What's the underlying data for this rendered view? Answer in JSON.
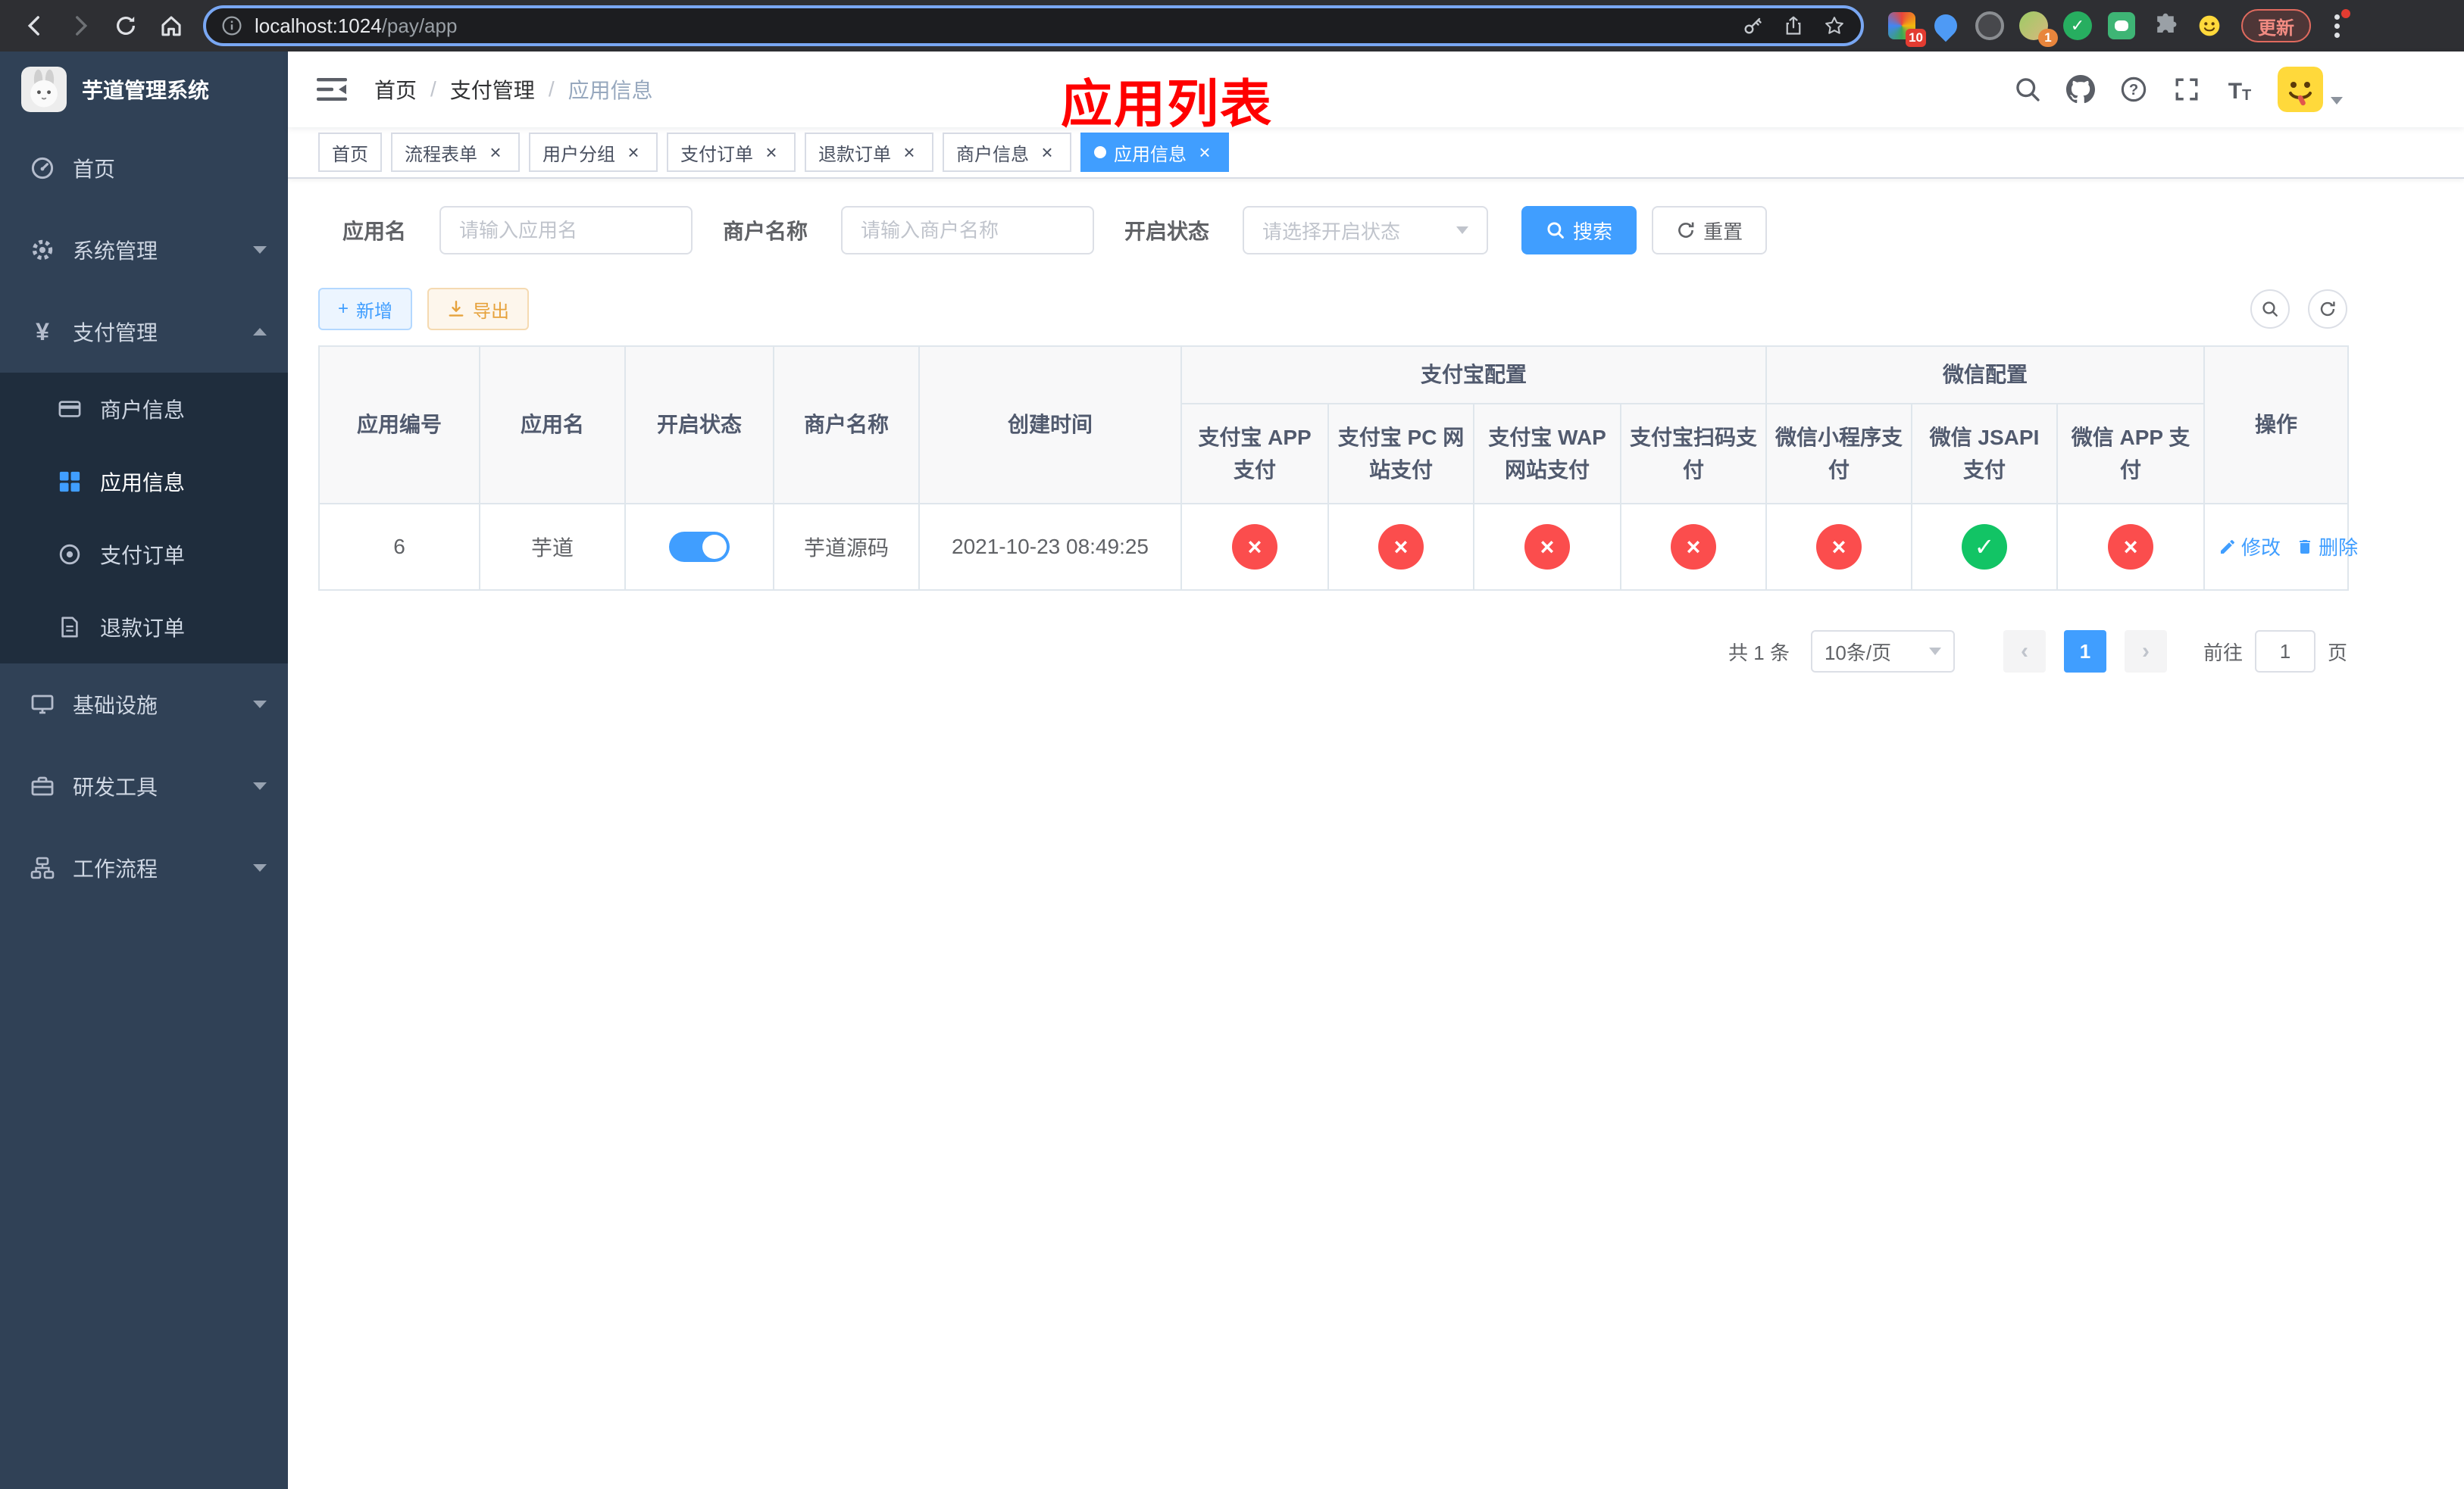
{
  "browser": {
    "url_host": "localhost:1024",
    "url_path": "/pay/app",
    "update_label": "更新",
    "ext_badge_count": "10",
    "avatar_badge_count": "1"
  },
  "app": {
    "logo_title": "芋道管理系统"
  },
  "sidebar": {
    "items": [
      {
        "label": "首页"
      },
      {
        "label": "系统管理"
      },
      {
        "label": "支付管理",
        "children": [
          {
            "label": "商户信息"
          },
          {
            "label": "应用信息"
          },
          {
            "label": "支付订单"
          },
          {
            "label": "退款订单"
          }
        ]
      },
      {
        "label": "基础设施"
      },
      {
        "label": "研发工具"
      },
      {
        "label": "工作流程"
      }
    ]
  },
  "header": {
    "breadcrumb": [
      "首页",
      "支付管理",
      "应用信息"
    ],
    "page_title": "应用列表"
  },
  "tabs": [
    {
      "label": "首页"
    },
    {
      "label": "流程表单"
    },
    {
      "label": "用户分组"
    },
    {
      "label": "支付订单"
    },
    {
      "label": "退款订单"
    },
    {
      "label": "商户信息"
    },
    {
      "label": "应用信息"
    }
  ],
  "filters": {
    "app_name": {
      "label": "应用名",
      "placeholder": "请输入应用名",
      "value": ""
    },
    "merchant_name": {
      "label": "商户名称",
      "placeholder": "请输入商户名称",
      "value": ""
    },
    "status": {
      "label": "开启状态",
      "placeholder": "请选择开启状态"
    },
    "search_label": "搜索",
    "reset_label": "重置"
  },
  "toolbar": {
    "add_label": "新增",
    "export_label": "导出"
  },
  "table": {
    "groups": [
      "支付宝配置",
      "微信配置"
    ],
    "columns": [
      "应用编号",
      "应用名",
      "开启状态",
      "商户名称",
      "创建时间",
      "支付宝 APP 支付",
      "支付宝 PC 网站支付",
      "支付宝 WAP 网站支付",
      "支付宝扫码支付",
      "微信小程序支付",
      "微信 JSAPI 支付",
      "微信 APP 支付",
      "操作"
    ],
    "rows": [
      {
        "id": "6",
        "name": "芋道",
        "enabled": true,
        "merchant": "芋道源码",
        "created": "2021-10-23 08:49:25",
        "alipay_app": false,
        "alipay_pc": false,
        "alipay_wap": false,
        "alipay_qr": false,
        "wechat_mini": false,
        "wechat_jsapi": true,
        "wechat_app": false,
        "edit_label": "修改",
        "delete_label": "删除"
      }
    ]
  },
  "pagination": {
    "total": "共 1 条",
    "page_size": "10条/页",
    "current_page": "1",
    "goto_label": "前往",
    "goto_value": "1",
    "unit_label": "页"
  },
  "colors": {
    "accent": "#409EFF",
    "danger": "#fb4d4d",
    "success": "#12c465",
    "title_red": "#ff0000",
    "sidebar_bg": "#304156",
    "submenu_bg": "#1f2d3d"
  }
}
